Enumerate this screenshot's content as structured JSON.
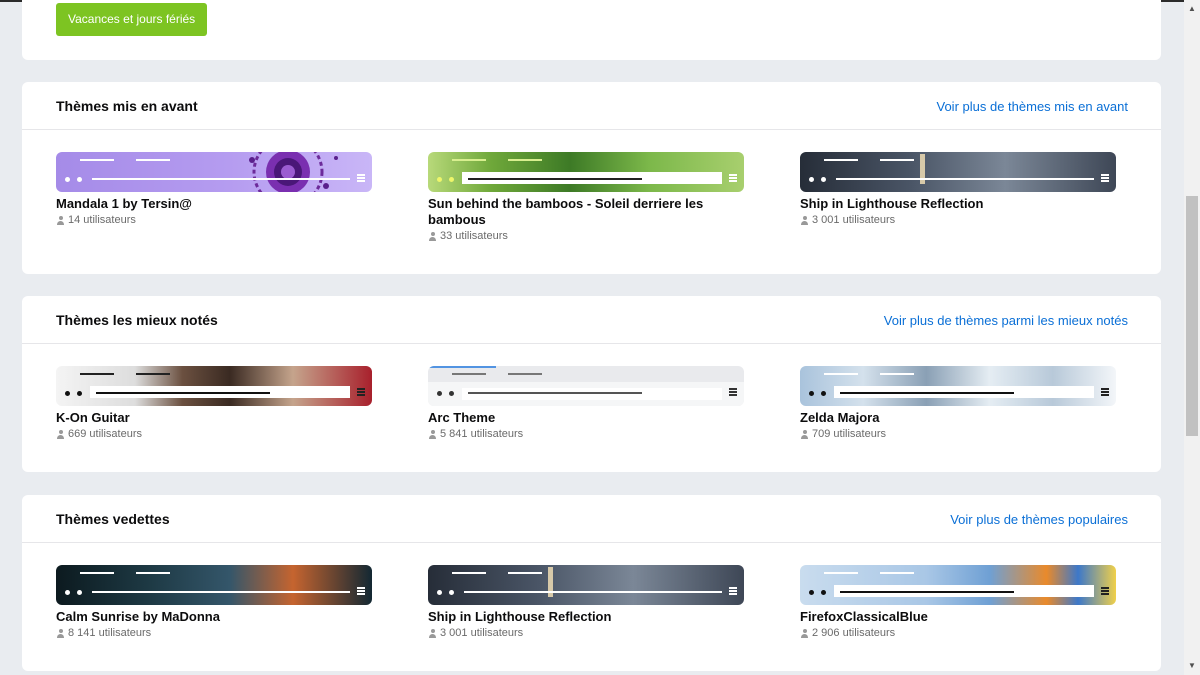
{
  "holiday_button": "Vacances et jours fériés",
  "sections": [
    {
      "title": "Thèmes mis en avant",
      "link": "Voir plus de thèmes mis en avant",
      "themes": [
        {
          "name": "Mandala 1 by Tersin@",
          "users": "14 utilisateurs"
        },
        {
          "name": "Sun behind the bamboos - Soleil derriere les bambous",
          "users": "33 utilisateurs"
        },
        {
          "name": "Ship in Lighthouse Reflection",
          "users": "3 001 utilisateurs"
        }
      ]
    },
    {
      "title": "Thèmes les mieux notés",
      "link": "Voir plus de thèmes parmi les mieux notés",
      "themes": [
        {
          "name": "K-On Guitar",
          "users": "669 utilisateurs"
        },
        {
          "name": "Arc Theme",
          "users": "5 841 utilisateurs"
        },
        {
          "name": "Zelda Majora",
          "users": "709 utilisateurs"
        }
      ]
    },
    {
      "title": "Thèmes vedettes",
      "link": "Voir plus de thèmes populaires",
      "themes": [
        {
          "name": "Calm Sunrise by MaDonna",
          "users": "8 141 utilisateurs"
        },
        {
          "name": "Ship in Lighthouse Reflection",
          "users": "3 001 utilisateurs"
        },
        {
          "name": "FirefoxClassicalBlue",
          "users": "2 906 utilisateurs"
        }
      ]
    }
  ],
  "colors": {
    "accent_green": "#7dc422",
    "link_blue": "#0a6fd6"
  },
  "icons": [
    "user-icon",
    "menu-icon",
    "scroll-up-arrow-icon",
    "scroll-down-arrow-icon"
  ]
}
